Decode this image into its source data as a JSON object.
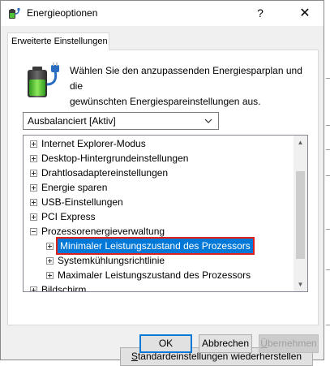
{
  "window": {
    "title": "Energieoptionen",
    "help_label": "?",
    "close_label": "✕"
  },
  "tab": {
    "label": "Erweiterte Einstellungen"
  },
  "description": {
    "line1": "Wählen Sie den anzupassenden Energiesparplan und die",
    "line2": "gewünschten Energiespareinstellungen aus."
  },
  "plan_select": {
    "selected": "Ausbalanciert [Aktiv]"
  },
  "tree": {
    "items": [
      {
        "label": "Internet Explorer-Modus",
        "indent": 0,
        "state": "collapsed"
      },
      {
        "label": "Desktop-Hintergrundeinstellungen",
        "indent": 0,
        "state": "collapsed"
      },
      {
        "label": "Drahtlosadaptereinstellungen",
        "indent": 0,
        "state": "collapsed"
      },
      {
        "label": "Energie sparen",
        "indent": 0,
        "state": "collapsed"
      },
      {
        "label": "USB-Einstellungen",
        "indent": 0,
        "state": "collapsed"
      },
      {
        "label": "PCI Express",
        "indent": 0,
        "state": "collapsed"
      },
      {
        "label": "Prozessorenergieverwaltung",
        "indent": 0,
        "state": "expanded"
      },
      {
        "label": "Minimaler Leistungszustand des Prozessors",
        "indent": 1,
        "state": "collapsed",
        "selected": true
      },
      {
        "label": "Systemkühlungsrichtlinie",
        "indent": 1,
        "state": "collapsed"
      },
      {
        "label": "Maximaler Leistungszustand des Prozessors",
        "indent": 1,
        "state": "collapsed"
      },
      {
        "label": "Bildschirm",
        "indent": 0,
        "state": "collapsed"
      }
    ]
  },
  "buttons": {
    "restore": {
      "pre": "",
      "accel": "S",
      "post": "tandardeinstellungen wiederherstellen"
    },
    "ok": "OK",
    "cancel": "Abbrechen",
    "apply": {
      "accel": "Ü",
      "post": "bernehmen"
    }
  },
  "colors": {
    "selection": "#0078d7",
    "highlight_outline": "#e0201b"
  }
}
